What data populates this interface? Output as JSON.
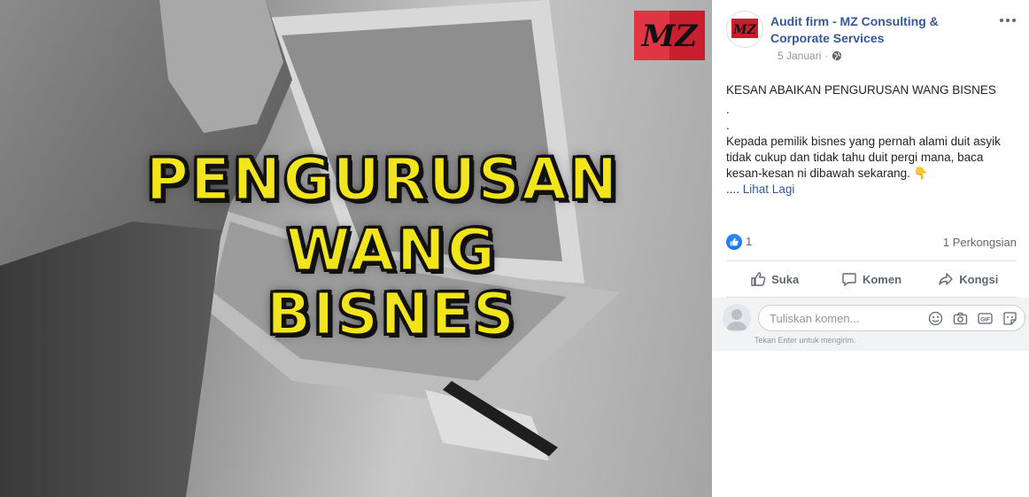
{
  "image": {
    "headline_lines": [
      "PENGURUSAN",
      "WANG",
      "BISNES"
    ],
    "logo_text": "MZ",
    "accent_yellow": "#f2e51b"
  },
  "post": {
    "page_name": "Audit firm - MZ Consulting & Corporate Services",
    "date": "5 Januari",
    "audience_icon": "globe-icon",
    "menu_icon": "more-horizontal-icon",
    "body_lines": [
      "KESAN ABAIKAN PENGURUSAN WANG BISNES",
      ".",
      ".",
      "Kepada pemilik bisnes yang pernah alami duit asyik tidak cukup dan tidak tahu duit pergi mana, baca kesan-kesan ni dibawah sekarang. 👇"
    ],
    "see_more_prefix": "....",
    "see_more_label": "Lihat Lagi"
  },
  "stats": {
    "like_count": "1",
    "share_count": "1 Perkongsian"
  },
  "actions": {
    "like_label": "Suka",
    "comment_label": "Komen",
    "share_label": "Kongsi"
  },
  "comment": {
    "placeholder": "Tuliskan komen...",
    "hint": "Tekan Enter untuk mengirim."
  },
  "colors": {
    "link_blue": "#365899",
    "fb_blue": "#1877f2",
    "muted": "#90949c"
  }
}
